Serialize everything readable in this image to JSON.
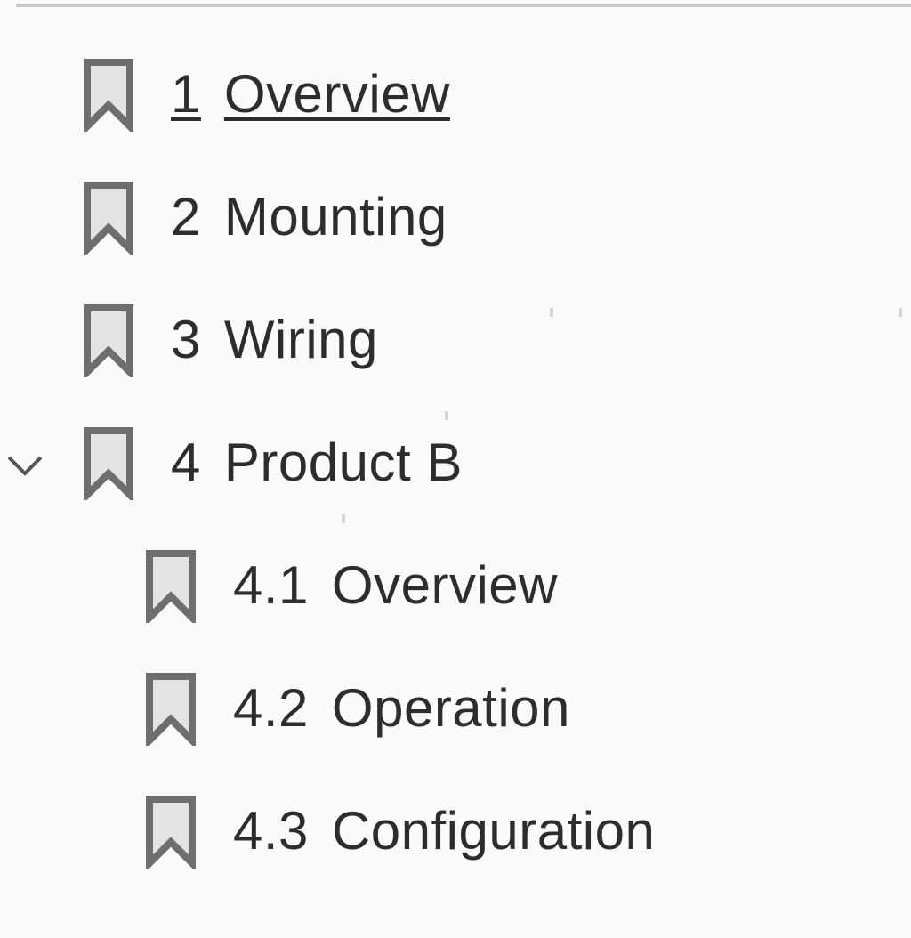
{
  "bookmarks": {
    "items": [
      {
        "number": "1",
        "title": "Overview",
        "active": true
      },
      {
        "number": "2",
        "title": "Mounting"
      },
      {
        "number": "3",
        "title": "Wiring"
      },
      {
        "number": "4",
        "title": "Product B",
        "expanded": true
      },
      {
        "number": "4.1",
        "title": "Overview"
      },
      {
        "number": "4.2",
        "title": "Operation"
      },
      {
        "number": "4.3",
        "title": "Configuration"
      }
    ]
  },
  "icons": {
    "bookmark": "bookmark-icon",
    "expand": "chevron-down-icon"
  },
  "colors": {
    "background": "#fafafa",
    "text": "#2d2d2d",
    "icon_stroke": "#6e6e6e",
    "icon_fill": "#e3e3e3"
  }
}
